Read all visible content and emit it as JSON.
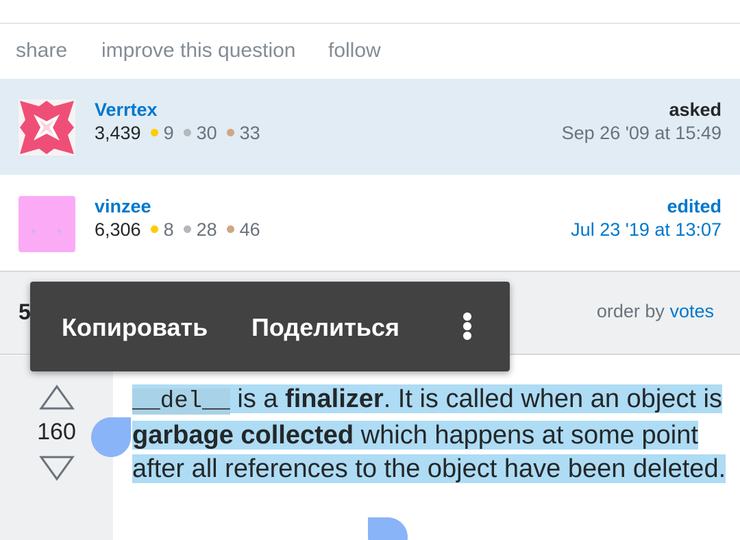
{
  "post_actions": {
    "share": "share",
    "improve": "improve this question",
    "follow": "follow"
  },
  "asked_card": {
    "action": "asked",
    "time": "Sep 26 '09 at 15:49",
    "user": "Verrtex",
    "reputation": "3,439",
    "gold": "9",
    "silver": "30",
    "bronze": "33"
  },
  "edited_card": {
    "action": "edited",
    "time": "Jul 23 '19 at 13:07",
    "user": "vinzee",
    "reputation": "6,306",
    "gold": "8",
    "silver": "28",
    "bronze": "46"
  },
  "answers_header": {
    "count": "5",
    "order_prefix": "order by",
    "order_value": "votes"
  },
  "answer": {
    "votes": "160",
    "code": "__del__",
    "text_1": " is a ",
    "bold_1": "finalizer",
    "text_2": ". It is called when an object is ",
    "bold_2": "garbage collected",
    "text_3": " which happens at some point after all references to the object have been deleted."
  },
  "context_menu": {
    "copy": "Копировать",
    "share": "Поделиться",
    "more_icon": "more-vert-icon"
  },
  "colors": {
    "link": "#0077cc",
    "selection": "#aedcf4",
    "handle": "#8ab4f8",
    "menu_bg": "#424242",
    "asked_bg": "#e1ecf4"
  }
}
